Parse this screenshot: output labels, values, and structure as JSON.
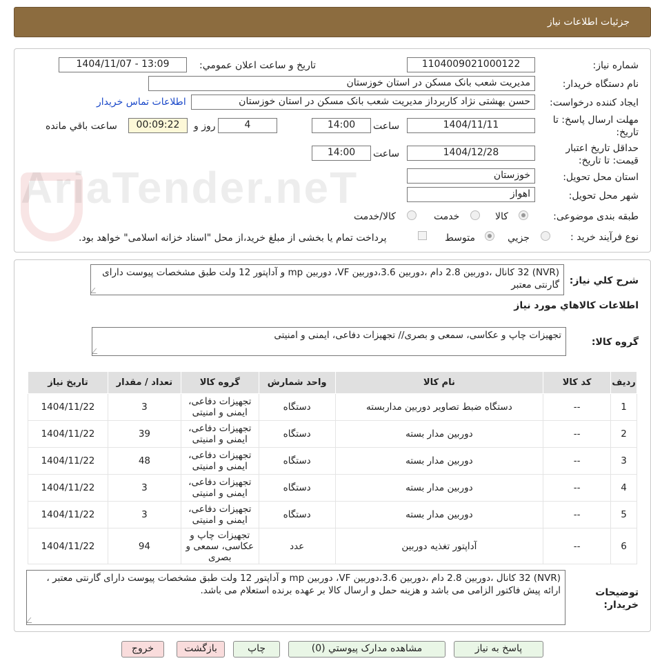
{
  "header": {
    "title": "جزئيات اطلاعات نياز"
  },
  "watermark": {
    "text": "AriaTender.neT"
  },
  "form": {
    "need_number_label": "شماره نياز:",
    "need_number": "1104009021000122",
    "announce_label": "تاريخ و ساعت اعلان عمومي:",
    "announce_value": "1404/11/07 - 13:09",
    "buyer_org_label": "نام دستگاه خريدار:",
    "buyer_org": "مديريت شعب بانک مسکن در استان خوزستان",
    "requester_label": "ايجاد کننده درخواست:",
    "requester": "حسن بهشتی نژاد کاربرداز مديريت شعب بانک مسکن در استان خوزستان",
    "contact_link": "اطلاعات تماس خريدار",
    "deadline_label": "مهلت ارسال پاسخ: تا تاريخ:",
    "deadline_date": "1404/11/11",
    "time_label": "ساعت",
    "deadline_time": "14:00",
    "days_value": "4",
    "days_label": "روز و",
    "remaining_time": "00:09:22",
    "remaining_label": "ساعت باقي مانده",
    "validity_label": "حداقل تاريخ اعتبار قيمت: تا تاريخ:",
    "validity_date": "1404/12/28",
    "validity_time": "14:00",
    "province_label": "استان محل تحويل:",
    "province": "خوزستان",
    "city_label": "شهر محل تحويل:",
    "city": "اهواز",
    "category_label": "طبقه بندی موضوعی:",
    "category_options": [
      "کالا",
      "خدمت",
      "کالا/خدمت"
    ],
    "process_label": "نوع فرآيند خريد :",
    "process_options": [
      "جزيي",
      "متوسط"
    ],
    "payment_note": "پرداخت تمام يا بخشی از مبلغ خريد،از محل \"اسناد خزانه اسلامی\" خواهد بود."
  },
  "details": {
    "summary_label": "شرح کلي نياز:",
    "summary": "(NVR) 32 کانال ،دوربين 2.8 دام ،دوربين 3.6،دوربين VF، دوربين mp و آداپتور 12 ولت طبق مشخصات پيوست دارای گارنتی معتبر",
    "items_section_title": "اطلاعات کالاهاي مورد نياز",
    "group_label": "گروه کالا:",
    "group_value": "تجهيزات چاپ و عکاسی، سمعی و بصری// تجهيزات دفاعی، ايمنی و امنيتی"
  },
  "table": {
    "headers": [
      "رديف",
      "کد کالا",
      "نام کالا",
      "واحد شمارش",
      "گروه کالا",
      "تعداد / مقدار",
      "تاريخ نياز"
    ],
    "rows": [
      [
        "1",
        "--",
        "دستگاه ضبط تصاوير دوربين مداربسته",
        "دستگاه",
        "تجهيزات دفاعی، ايمنی و امنيتی",
        "3",
        "1404/11/22"
      ],
      [
        "2",
        "--",
        "دوربين مدار بسته",
        "دستگاه",
        "تجهيزات دفاعی، ايمنی و امنيتی",
        "39",
        "1404/11/22"
      ],
      [
        "3",
        "--",
        "دوربين مدار بسته",
        "دستگاه",
        "تجهيزات دفاعی، ايمنی و امنيتی",
        "48",
        "1404/11/22"
      ],
      [
        "4",
        "--",
        "دوربين مدار بسته",
        "دستگاه",
        "تجهيزات دفاعی، ايمنی و امنيتی",
        "3",
        "1404/11/22"
      ],
      [
        "5",
        "--",
        "دوربين مدار بسته",
        "دستگاه",
        "تجهيزات دفاعی، ايمنی و امنيتی",
        "3",
        "1404/11/22"
      ],
      [
        "6",
        "--",
        "آداپتور تغذيه دوربين",
        "عدد",
        "تجهيزات چاپ و عکاسی، سمعی و بصری",
        "94",
        "1404/11/22"
      ]
    ]
  },
  "notes": {
    "label": "توضيحات خريدار:",
    "text": "(NVR) 32 کانال ،دوربين 2.8 دام ،دوربين 3.6،دوربين VF، دوربين mp و آداپتور 12 ولت طبق مشخصات پيوست دارای گارنتی معتبر ، ارائه پيش فاکتور الزامی می باشد و هزينه حمل و ارسال کالا بر عهده برنده استعلام می باشد."
  },
  "buttons": {
    "reply": "پاسخ به نياز",
    "attachments": "مشاهده مدارک پيوستي (0)",
    "print": "چاپ",
    "back": "بازگشت",
    "exit": "خروج"
  }
}
